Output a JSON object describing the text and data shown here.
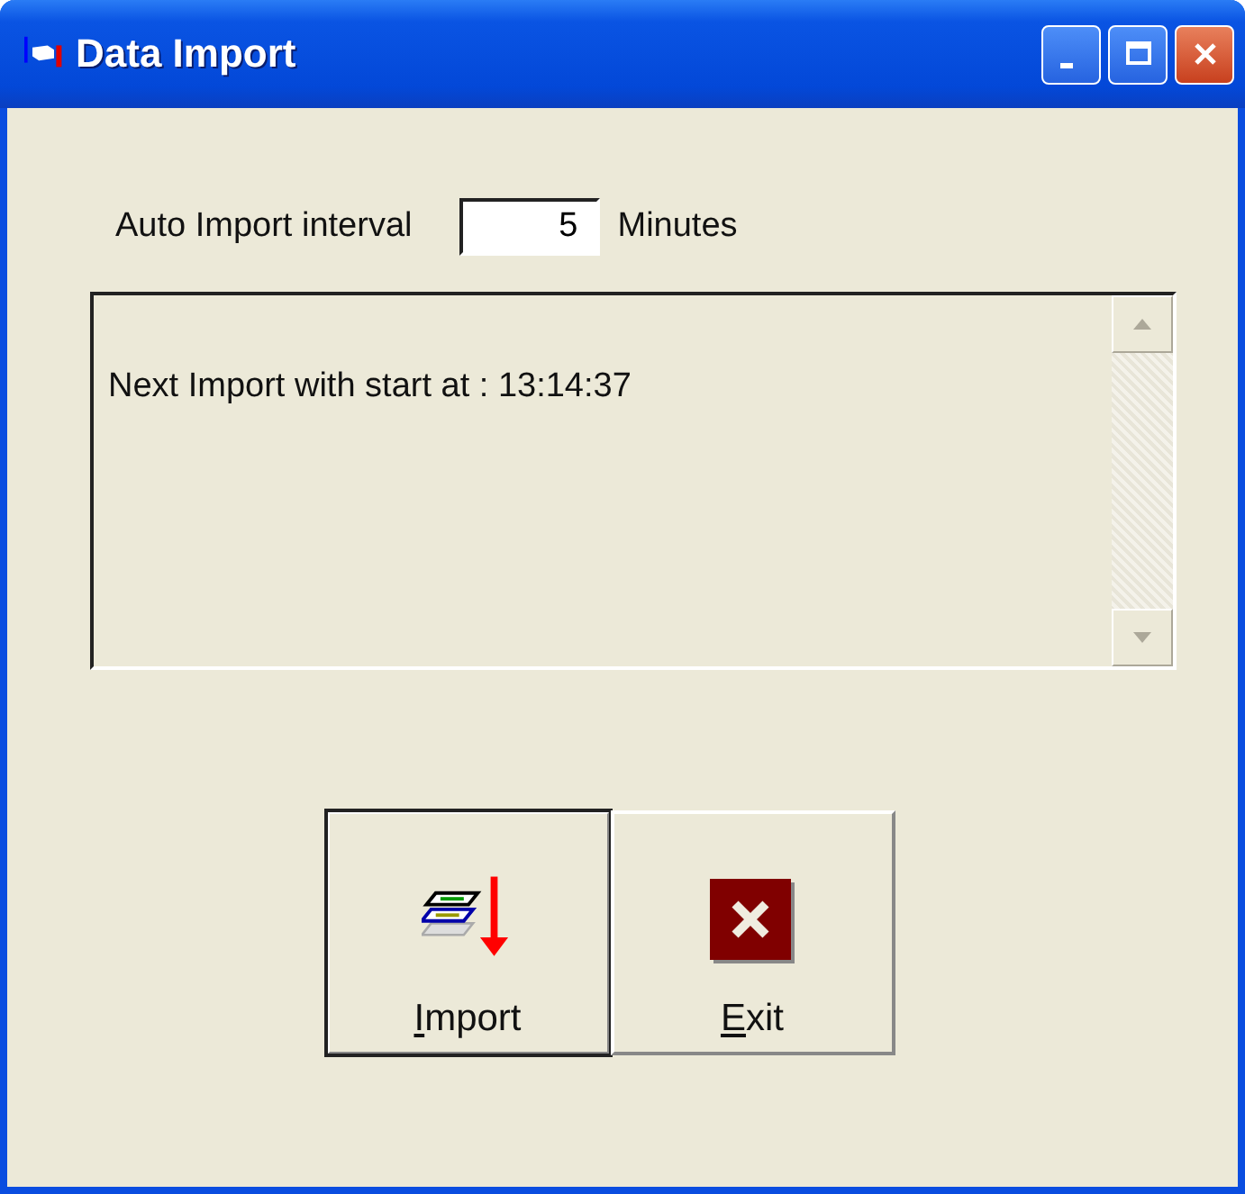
{
  "window": {
    "title": "Data Import"
  },
  "interval": {
    "label": "Auto Import interval",
    "value": "5",
    "unit": "Minutes"
  },
  "log": {
    "lines": [
      "Next Import with start at : 13:14:37"
    ]
  },
  "buttons": [
    {
      "kind": "import",
      "access_key": "I",
      "rest": "mport",
      "focused": true
    },
    {
      "kind": "exit",
      "access_key": "E",
      "rest": "xit",
      "focused": false
    }
  ]
}
